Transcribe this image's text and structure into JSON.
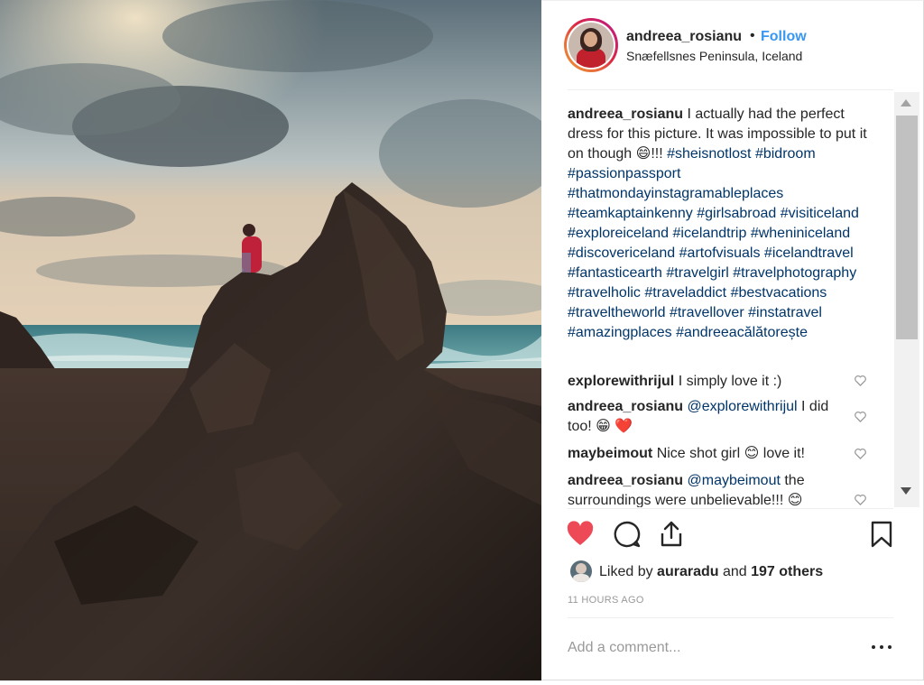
{
  "post": {
    "username": "andreea_rosianu",
    "separator": "•",
    "follow_label": "Follow",
    "location": "Snæfellsnes Peninsula, Iceland"
  },
  "caption": {
    "username": "andreea_rosianu",
    "text_1": " I actually had the perfect dress for this picture. It was impossible to put it on though ",
    "emoji": "😄",
    "text_2": "!!! ",
    "hashtags": [
      "#sheisnotlost",
      "#bidroom",
      "#passionpassport",
      "#thatmondayinstagramableplaces",
      "#teamkaptainkenny",
      "#girlsabroad",
      "#visiticeland",
      "#exploreiceland",
      "#icelandtrip",
      "#wheniniceland",
      "#discovericeland",
      "#artofvisuals",
      "#icelandtravel",
      "#fantasticearth",
      "#travelgirl",
      "#travelphotography",
      "#travelholic",
      "#traveladdict",
      "#bestvacations",
      "#traveltheworld",
      "#travellover",
      "#instatravel",
      "#amazingplaces",
      "#andreeacălătorește"
    ]
  },
  "comments": [
    {
      "username": "explorewithrijul",
      "text": " I simply love it :)"
    },
    {
      "username": "andreea_rosianu",
      "mention": "@explorewithrijul",
      "text": " I did too! ",
      "emoji": "😁 ❤️"
    },
    {
      "username": "maybeimout",
      "text": " Nice shot girl ",
      "emoji": "😊",
      "text_2": " love it!"
    },
    {
      "username": "andreea_rosianu",
      "mention": "@maybeimout",
      "text": " the surroundings were unbelievable!!! ",
      "emoji": "😊"
    }
  ],
  "likes": {
    "prefix": "Liked by ",
    "user": "auraradu",
    "middle": " and ",
    "count": "197 others"
  },
  "timestamp": "11 HOURS AGO",
  "add_comment_placeholder": "Add a comment...",
  "icons": {
    "like": "heart-filled-icon",
    "comment": "comment-bubble-icon",
    "share": "share-upload-icon",
    "save": "bookmark-icon",
    "more": "more-options-icon"
  },
  "colors": {
    "link": "#003569",
    "follow": "#3897f0",
    "liked_heart": "#ed4956",
    "muted": "#999999",
    "text": "#262626"
  }
}
